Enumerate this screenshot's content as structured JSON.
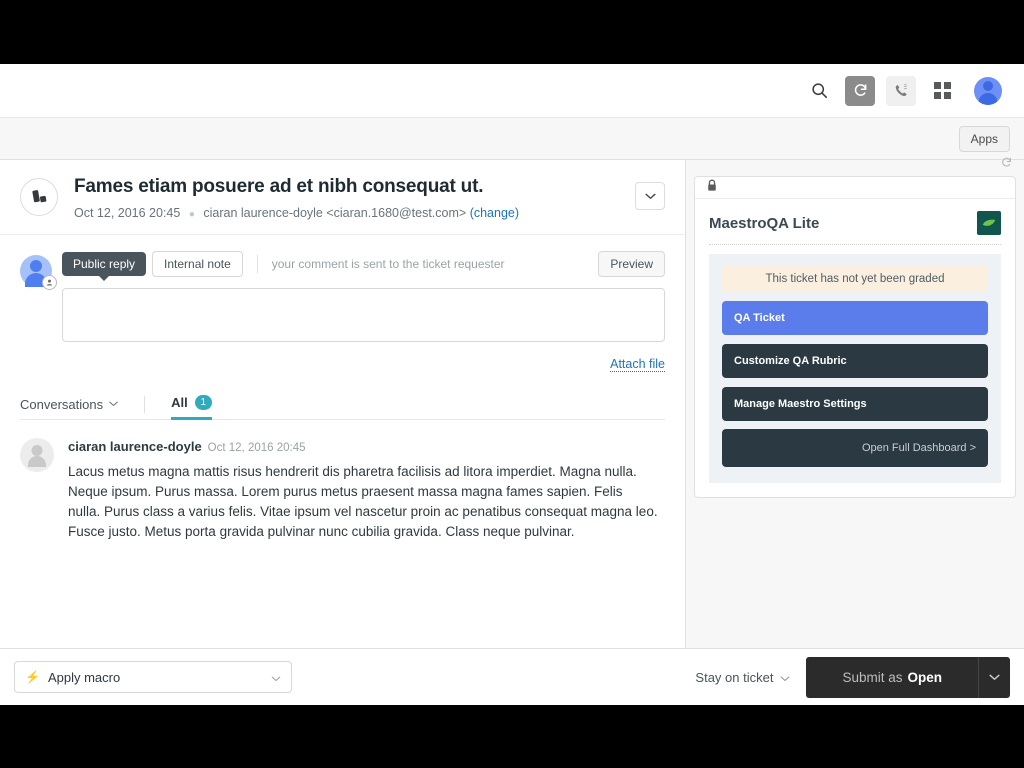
{
  "topbar": {
    "icons": [
      {
        "name": "search-icon",
        "label": "Search"
      },
      {
        "name": "refresh-icon",
        "label": "Refresh"
      },
      {
        "name": "phone-icon",
        "label": "Talk"
      },
      {
        "name": "apps-grid-icon",
        "label": "Products"
      },
      {
        "name": "user-avatar",
        "label": "Profile"
      }
    ]
  },
  "apps_row": {
    "apps_label": "Apps"
  },
  "ticket": {
    "title": "Fames etiam posuere ad et nibh consequat ut.",
    "date": "Oct 12, 2016 20:45",
    "separator": "●",
    "requester": "ciaran laurence-doyle <ciaran.1680@test.com>",
    "change_link": "(change)",
    "expand_icon": "chevron-down-icon"
  },
  "composer": {
    "public_reply_label": "Public reply",
    "internal_note_label": "Internal note",
    "hint": "your comment is sent to the ticket requester",
    "preview_label": "Preview",
    "comment_value": "",
    "comment_placeholder": "",
    "attach_label": "Attach file"
  },
  "conversations": {
    "selector_label": "Conversations",
    "tab_all_label": "All",
    "tab_all_count": "1"
  },
  "comment": {
    "author": "ciaran laurence-doyle",
    "timestamp": "Oct 12, 2016 20:45",
    "body": "Lacus metus magna mattis risus hendrerit dis pharetra facilisis ad litora imperdiet. Magna nulla. Neque ipsum. Purus massa. Lorem purus metus praesent massa magna fames sapien. Felis nulla. Purus class a varius felis. Vitae ipsum vel nascetur proin ac penatibus consequat magna leo. Fusce justo. Metus porta gravida pulvinar nunc cubilia gravida. Class neque pulvinar."
  },
  "app_panel": {
    "lock_icon": "lock-icon",
    "refresh_icon": "refresh-icon",
    "title": "MaestroQA Lite",
    "logo_icon": "leaf-logo-icon",
    "grade_status": "This ticket has not yet been graded",
    "buttons": [
      {
        "label": "QA Ticket",
        "style": "blue"
      },
      {
        "label": "Customize QA Rubric",
        "style": "dark"
      },
      {
        "label": "Manage Maestro Settings",
        "style": "dark"
      }
    ],
    "dashboard_label": "Open Full Dashboard >"
  },
  "footer": {
    "macro_label": "Apply macro",
    "macro_icon": "bolt-icon",
    "stay_label": "Stay on ticket",
    "submit_prefix": "Submit as",
    "submit_status": "Open"
  },
  "colors": {
    "accent_teal": "#30aabc",
    "link_blue": "#1f73b7",
    "qa_blue": "#5b7ceb",
    "qa_dark": "#2b3a42",
    "banner_cream": "#fbf0e0",
    "submit_dark": "#2b2b2b"
  }
}
